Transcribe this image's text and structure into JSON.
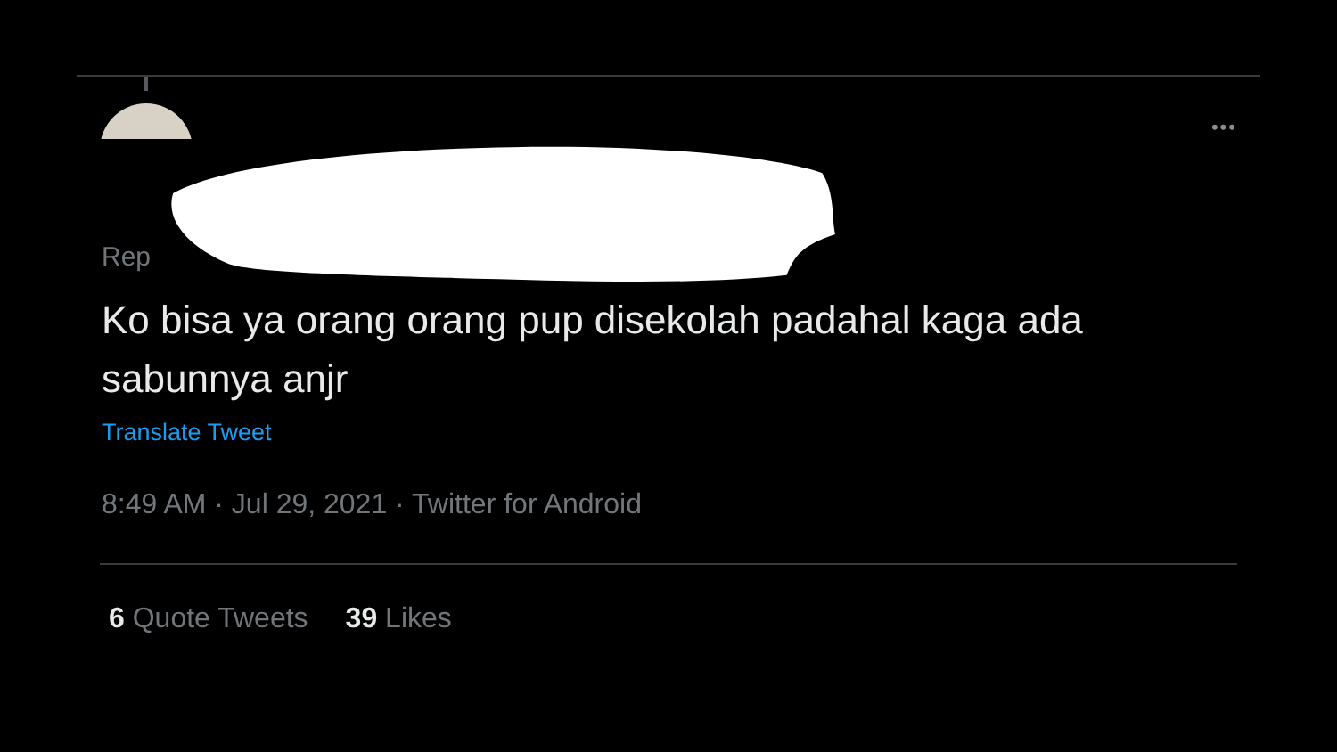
{
  "tweet": {
    "reply_prefix": "Rep",
    "more": "•••",
    "text": "Ko bisa ya orang orang pup disekolah padahal kaga ada sabunnya anjr",
    "translate": "Translate Tweet",
    "meta": "8:49 AM · Jul 29, 2021 · Twitter for Android",
    "stats": [
      {
        "count": "6",
        "label": "Quote Tweets"
      },
      {
        "count": "39",
        "label": "Likes"
      }
    ]
  }
}
